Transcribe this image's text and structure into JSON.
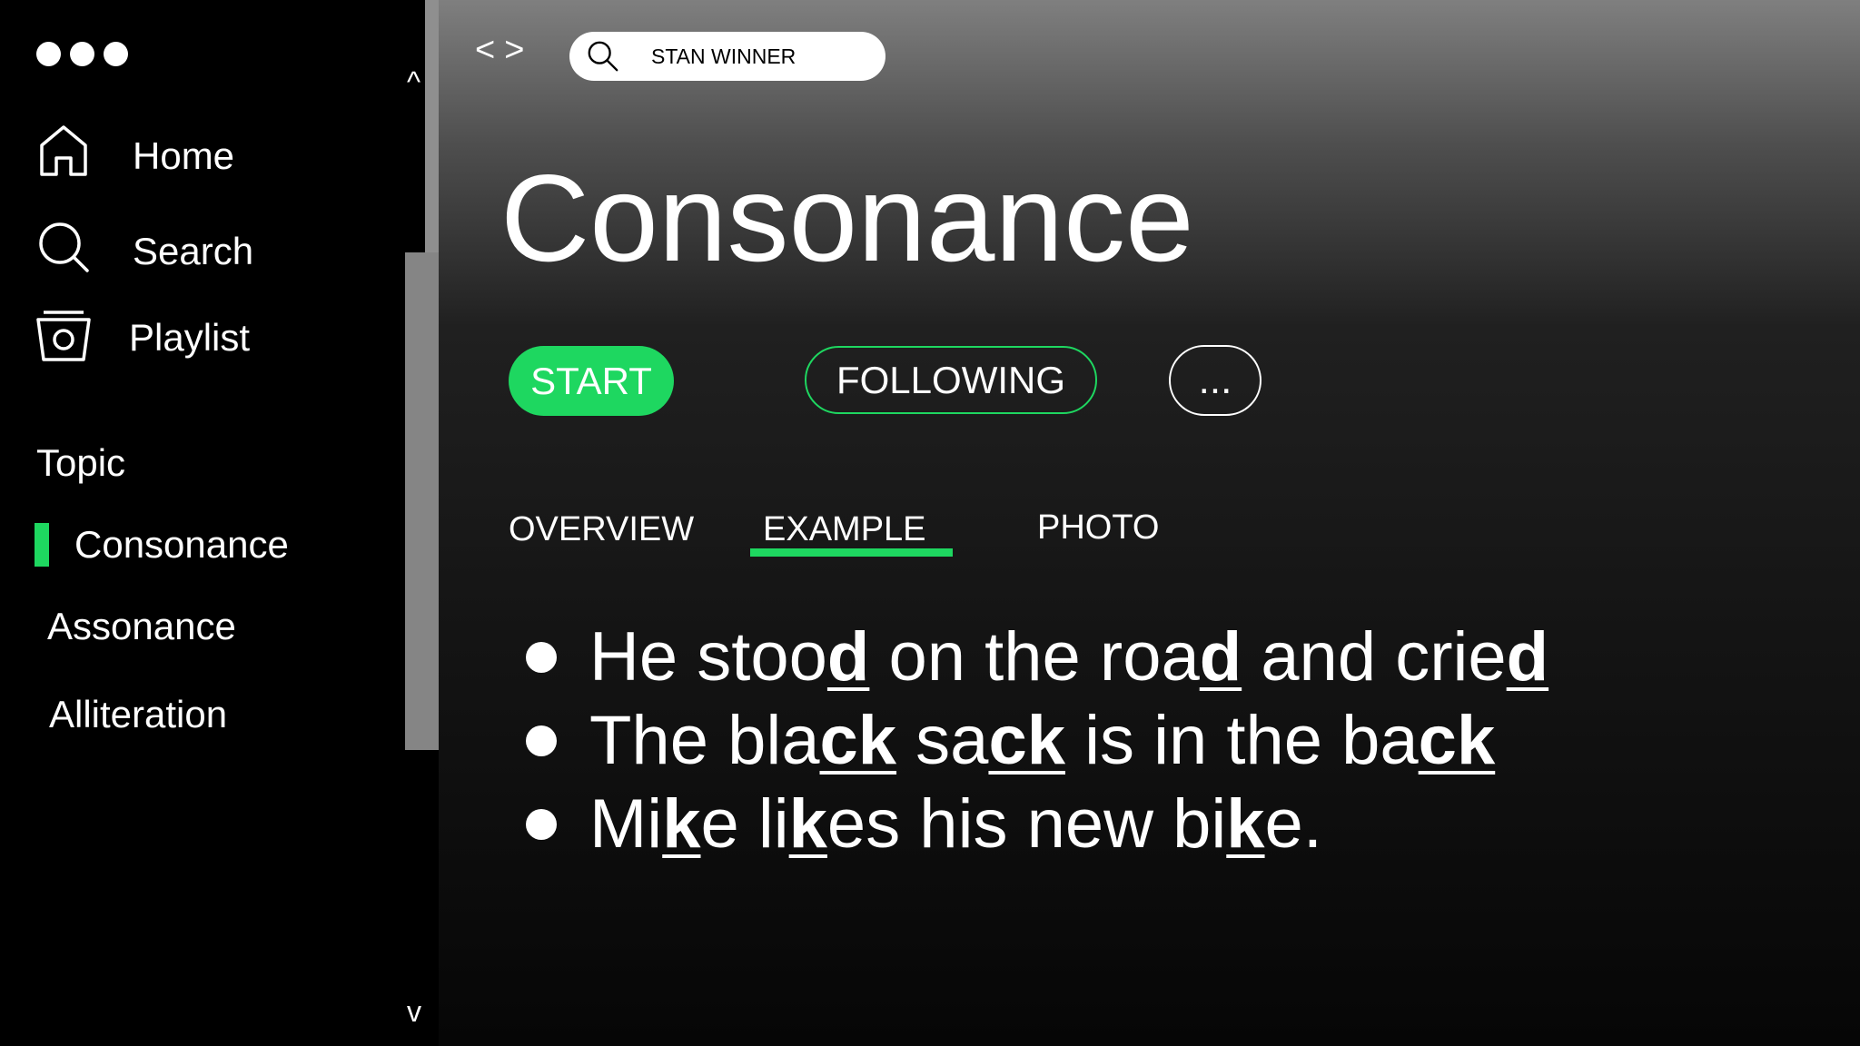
{
  "sidebar": {
    "nav": [
      {
        "label": "Home",
        "icon": "home-icon"
      },
      {
        "label": "Search",
        "icon": "search-icon"
      },
      {
        "label": "Playlist",
        "icon": "playlist-icon"
      }
    ],
    "topic_heading": "Topic",
    "topics": [
      {
        "label": "Consonance",
        "active": true
      },
      {
        "label": "Assonance",
        "active": false
      },
      {
        "label": "Alliteration",
        "active": false
      }
    ],
    "scroll_up": "^",
    "scroll_down": "v"
  },
  "header": {
    "back": "<",
    "forward": ">",
    "search_value": "STAN WINNER"
  },
  "main": {
    "title": "Consonance",
    "buttons": {
      "start": "START",
      "following": "FOLLOWING",
      "more": "..."
    },
    "tabs": [
      {
        "label": "OVERVIEW",
        "active": false
      },
      {
        "label": "EXAMPLE",
        "active": true
      },
      {
        "label": "PHOTO",
        "active": false
      }
    ],
    "examples": [
      [
        {
          "t": "He stoo"
        },
        {
          "t": "d",
          "u": true
        },
        {
          "t": " on the roa"
        },
        {
          "t": "d",
          "u": true
        },
        {
          "t": " and crie"
        },
        {
          "t": "d",
          "u": true
        }
      ],
      [
        {
          "t": "The bla"
        },
        {
          "t": "ck",
          "u": true
        },
        {
          "t": " sa"
        },
        {
          "t": "ck",
          "u": true
        },
        {
          "t": " is in the ba"
        },
        {
          "t": "ck",
          "u": true
        }
      ],
      [
        {
          "t": "Mi"
        },
        {
          "t": "k",
          "u": true
        },
        {
          "t": "e li"
        },
        {
          "t": "k",
          "u": true
        },
        {
          "t": "es his new bi"
        },
        {
          "t": "k",
          "u": true
        },
        {
          "t": "e."
        }
      ]
    ]
  },
  "colors": {
    "accent": "#1ed760",
    "sidebar_bg": "#000000",
    "text": "#ffffff"
  }
}
